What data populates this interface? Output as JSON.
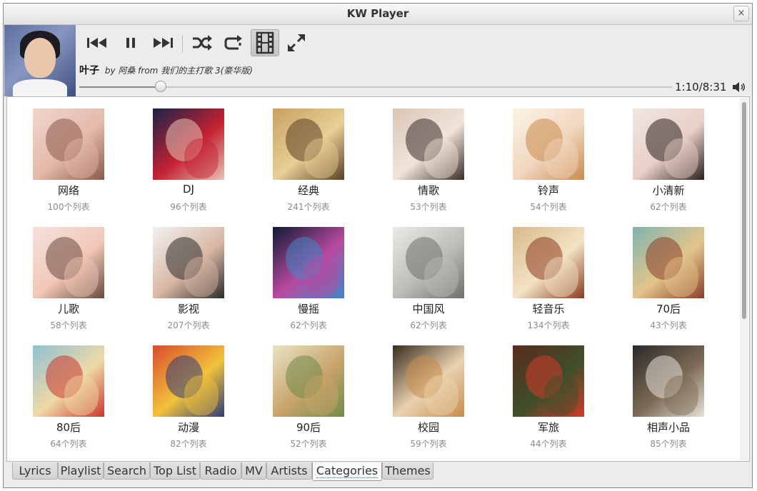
{
  "window": {
    "title": "KW Player",
    "close_icon": "×"
  },
  "player": {
    "song_title": "叶子",
    "song_meta": "by 阿桑 from 我们的主打歌 3(豪华版)",
    "time": "1:10/8:31",
    "progress": 0.137,
    "controls": [
      "previous-icon",
      "pause-icon",
      "next-icon",
      "shuffle-icon",
      "repeat-icon",
      "mv-film-icon",
      "fullscreen-icon"
    ]
  },
  "categories": [
    {
      "name": "网络",
      "count": "100个列表",
      "c1": "#f0d6cd",
      "c2": "#8a5a4c",
      "c3": "#e4b9aa"
    },
    {
      "name": "DJ",
      "count": "96个列表",
      "c1": "#1a2348",
      "c2": "#e7c3b5",
      "c3": "#c42232"
    },
    {
      "name": "经典",
      "count": "241个列表",
      "c1": "#c9a062",
      "c2": "#5b4023",
      "c3": "#e7cf95"
    },
    {
      "name": "情歌",
      "count": "53个列表",
      "c1": "#d9c6b8",
      "c2": "#3a2e2a",
      "c3": "#f0e4d8"
    },
    {
      "name": "铃声",
      "count": "54个列表",
      "c1": "#fbf4e6",
      "c2": "#c98b4c",
      "c3": "#f1d6bf"
    },
    {
      "name": "小清新",
      "count": "62个列表",
      "c1": "#efe7e4",
      "c2": "#2a2120",
      "c3": "#e9cfc6"
    },
    {
      "name": "儿歌",
      "count": "58个列表",
      "c1": "#f4e2dc",
      "c2": "#6b4a3e",
      "c3": "#f1c7b8"
    },
    {
      "name": "影视",
      "count": "207个列表",
      "c1": "#f1f1f1",
      "c2": "#2b2b2b",
      "c3": "#d9b7a3"
    },
    {
      "name": "慢摇",
      "count": "62个列表",
      "c1": "#0f1a33",
      "c2": "#3f87c7",
      "c3": "#b84aa0"
    },
    {
      "name": "中国风",
      "count": "62个列表",
      "c1": "#e9e9e6",
      "c2": "#6f6f6b",
      "c3": "#bdbdb8"
    },
    {
      "name": "轻音乐",
      "count": "134个列表",
      "c1": "#d7b98c",
      "c2": "#8c3b1f",
      "c3": "#f3e3c4"
    },
    {
      "name": "70后",
      "count": "43个列表",
      "c1": "#7fb3b0",
      "c2": "#8b3e2a",
      "c3": "#e3c58a"
    },
    {
      "name": "80后",
      "count": "64个列表",
      "c1": "#8fc1d4",
      "c2": "#c9372e",
      "c3": "#efd9a6"
    },
    {
      "name": "动漫",
      "count": "82个列表",
      "c1": "#d94b2f",
      "c2": "#2f3c7a",
      "c3": "#f2c23a"
    },
    {
      "name": "90后",
      "count": "52个列表",
      "c1": "#e8e3c4",
      "c2": "#6f8b4a",
      "c3": "#c9a36a"
    },
    {
      "name": "校园",
      "count": "59个列表",
      "c1": "#3a2b1f",
      "c2": "#c98c4a",
      "c3": "#e9d2b0"
    },
    {
      "name": "军旅",
      "count": "44个列表",
      "c1": "#5a2a1e",
      "c2": "#d43a28",
      "c3": "#3e4f2a"
    },
    {
      "name": "相声小品",
      "count": "85个列表",
      "c1": "#2a2a2a",
      "c2": "#e8e2d8",
      "c3": "#7c6a55"
    }
  ],
  "tabs": [
    {
      "label": "Lyrics",
      "active": false
    },
    {
      "label": "Playlist",
      "active": false
    },
    {
      "label": "Search",
      "active": false
    },
    {
      "label": "Top List",
      "active": false
    },
    {
      "label": "Radio",
      "active": false
    },
    {
      "label": "MV",
      "active": false
    },
    {
      "label": "Artists",
      "active": false
    },
    {
      "label": "Categories",
      "active": true
    },
    {
      "label": "Themes",
      "active": false
    }
  ]
}
